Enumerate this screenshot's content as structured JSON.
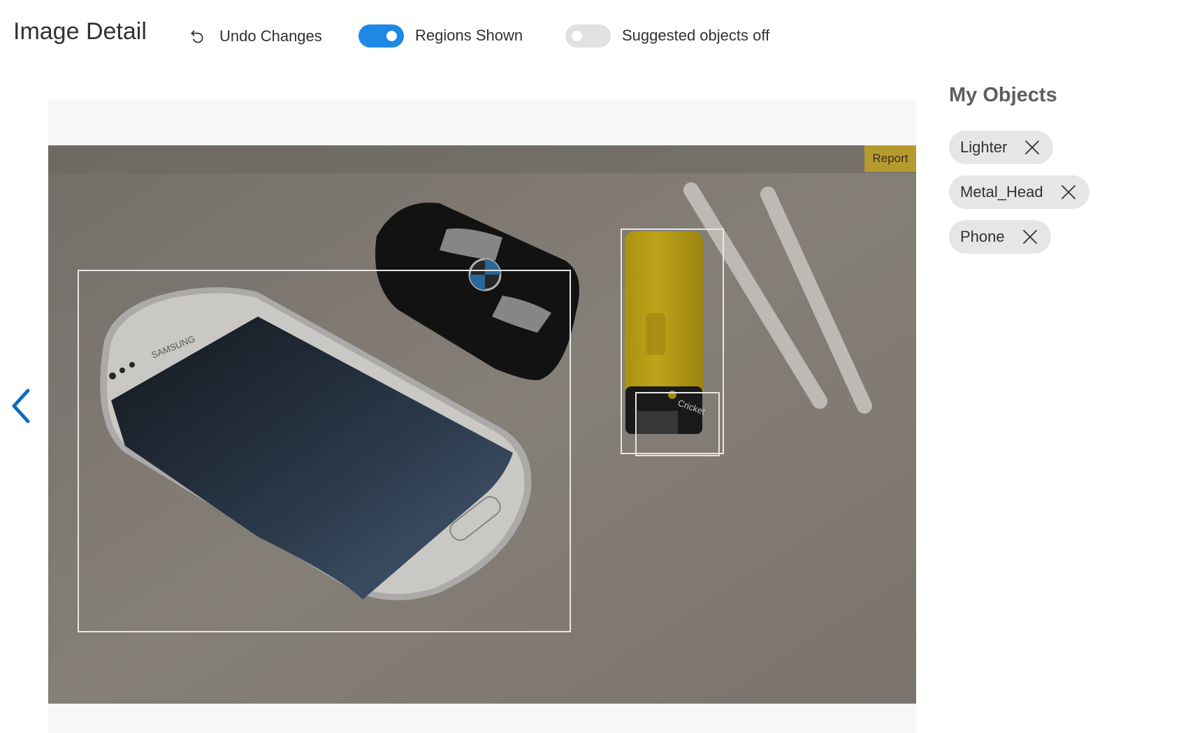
{
  "header": {
    "title": "Image Detail",
    "undo_label": "Undo Changes",
    "regions_toggle": {
      "label": "Regions Shown",
      "state": "on"
    },
    "suggested_toggle": {
      "label": "Suggested objects off",
      "state": "off"
    }
  },
  "viewer": {
    "report_label": "Report",
    "regions": [
      {
        "tag": "Phone"
      },
      {
        "tag": "Lighter"
      },
      {
        "tag": "Metal_Head"
      }
    ]
  },
  "sidebar": {
    "title": "My Objects",
    "tags": [
      {
        "label": "Lighter"
      },
      {
        "label": "Metal_Head"
      },
      {
        "label": "Phone"
      }
    ]
  },
  "icons": {
    "undo": "undo-icon",
    "prev": "chevron-left-icon",
    "close": "close-icon"
  },
  "colors": {
    "accent": "#1e88e5",
    "report": "#b79a2e",
    "chip": "#e6e6e6",
    "region_border": "#e6e6e6"
  }
}
